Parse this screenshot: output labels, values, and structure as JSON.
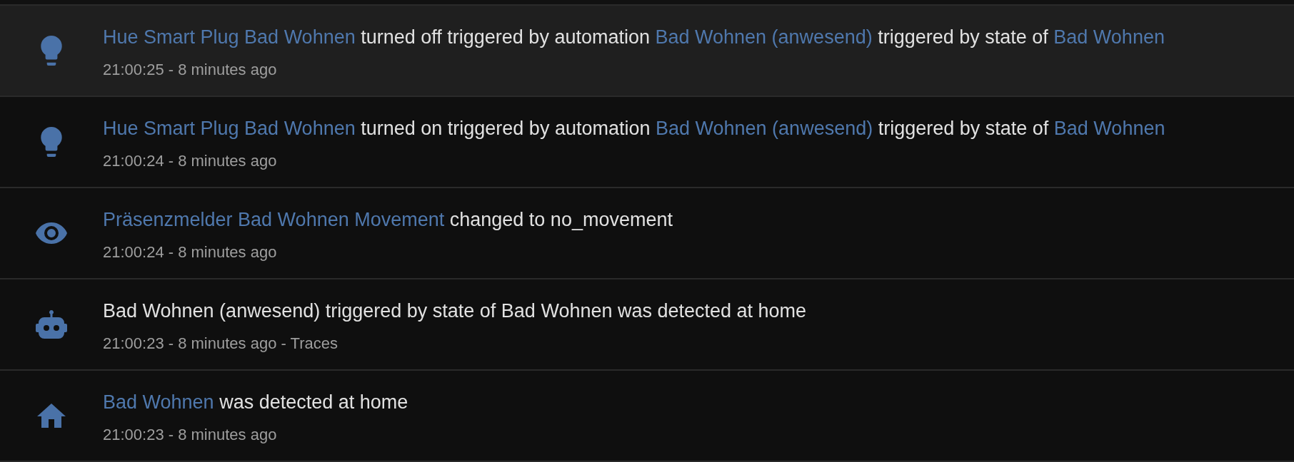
{
  "entries": [
    {
      "kind": "bulb",
      "selected": true,
      "message": [
        {
          "text": "Hue Smart Plug Bad Wohnen",
          "link": true
        },
        {
          "text": " turned off triggered by automation ",
          "link": false
        },
        {
          "text": "Bad Wohnen (anwesend)",
          "link": true
        },
        {
          "text": " triggered by state of ",
          "link": false
        },
        {
          "text": "Bad Wohnen",
          "link": true
        }
      ],
      "time": "21:00:25 - 8 minutes ago"
    },
    {
      "kind": "bulb",
      "selected": false,
      "message": [
        {
          "text": "Hue Smart Plug Bad Wohnen",
          "link": true
        },
        {
          "text": " turned on triggered by automation ",
          "link": false
        },
        {
          "text": "Bad Wohnen (anwesend)",
          "link": true
        },
        {
          "text": " triggered by state of ",
          "link": false
        },
        {
          "text": "Bad Wohnen",
          "link": true
        }
      ],
      "time": "21:00:24 - 8 minutes ago"
    },
    {
      "kind": "eye",
      "selected": false,
      "message": [
        {
          "text": "Präsenzmelder Bad Wohnen Movement",
          "link": true
        },
        {
          "text": " changed to no_movement",
          "link": false
        }
      ],
      "time": "21:00:24 - 8 minutes ago"
    },
    {
      "kind": "robot",
      "selected": false,
      "message": [
        {
          "text": "Bad Wohnen (anwesend) triggered by state of Bad Wohnen was detected at home",
          "link": false
        }
      ],
      "time": "21:00:23 - 8 minutes ago",
      "separator": " - ",
      "traces": "Traces"
    },
    {
      "kind": "home",
      "selected": false,
      "message": [
        {
          "text": "Bad Wohnen",
          "link": true
        },
        {
          "text": " was detected at home",
          "link": false
        }
      ],
      "time": "21:00:23 - 8 minutes ago"
    }
  ]
}
